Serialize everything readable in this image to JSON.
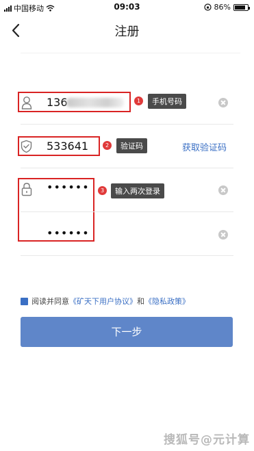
{
  "status_bar": {
    "carrier": "中国移动",
    "time": "09:03",
    "battery_percent": "86%",
    "battery_level": 0.86,
    "icons": [
      "signal-icon",
      "wifi-icon",
      "orientation-lock-icon",
      "battery-icon"
    ]
  },
  "nav": {
    "title": "注册",
    "back_icon": "chevron-left-icon"
  },
  "phone": {
    "icon": "user-icon",
    "value": "136",
    "badge": "1",
    "tooltip": "手机号码"
  },
  "code": {
    "icon": "shield-icon",
    "value": "533641",
    "badge": "2",
    "tooltip": "验证码",
    "get_code_label": "获取验证码"
  },
  "password": {
    "icon": "lock-icon",
    "value": "••••••",
    "confirm_value": "••••••",
    "badge": "3",
    "tooltip": "输入两次登录"
  },
  "agreement": {
    "prefix": "阅读并同意",
    "terms": "《矿天下用户协议》",
    "and": "和",
    "privacy": "《隐私政策》"
  },
  "next_button": {
    "label": "下一步"
  },
  "watermark": "搜狐号@元计算",
  "colors": {
    "accent": "#3a6fc4",
    "button": "#5f86c9",
    "highlight": "#d92323"
  }
}
